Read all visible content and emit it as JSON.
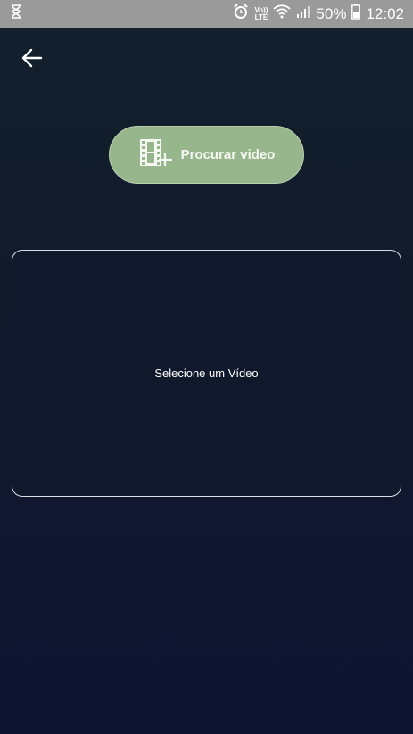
{
  "status_bar": {
    "volte_top": "Vo))",
    "volte_bottom": "LTE",
    "battery": "50%",
    "time": "12:02"
  },
  "header": {
    "back_icon": "arrow-left-icon"
  },
  "actions": {
    "browse_label": "Procurar video",
    "browse_icon": "film-add-icon"
  },
  "preview": {
    "placeholder": "Selecione um Vídeo"
  },
  "colors": {
    "accent": "#97b68b",
    "background_top": "#13202c",
    "background_bottom": "#0f1431",
    "status_bar": "#9a9a9a"
  }
}
